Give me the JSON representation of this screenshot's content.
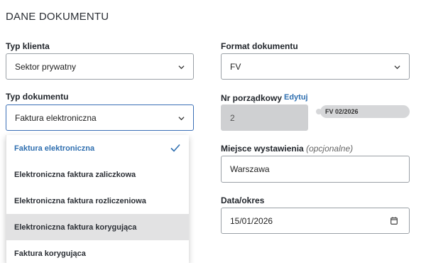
{
  "section_title": "DANE DOKUMENTU",
  "client_type": {
    "label": "Typ klienta",
    "value": "Sektor prywatny"
  },
  "doc_format": {
    "label": "Format dokumentu",
    "value": "FV"
  },
  "doc_type": {
    "label": "Typ dokumentu",
    "value": "Faktura elektroniczna",
    "options": [
      "Faktura elektroniczna",
      "Elektroniczna faktura zaliczkowa",
      "Elektroniczna faktura rozliczeniowa",
      "Elektroniczna faktura korygująca",
      "Faktura korygująca"
    ],
    "selected_index": 0,
    "hover_index": 3
  },
  "order_number": {
    "label": "Nr porządkowy",
    "edit_label": "Edytuj",
    "value": "2",
    "preview": "FV 02/2026"
  },
  "issue_place": {
    "label": "Miejsce wystawienia",
    "optional": "(opcjonalne)",
    "value": "Warszawa"
  },
  "date": {
    "label": "Data/okres",
    "value": "15/01/2026"
  },
  "colors": {
    "accent": "#2f6fb0",
    "border": "#9aa0a6",
    "disabled": "#cfd0d2"
  }
}
